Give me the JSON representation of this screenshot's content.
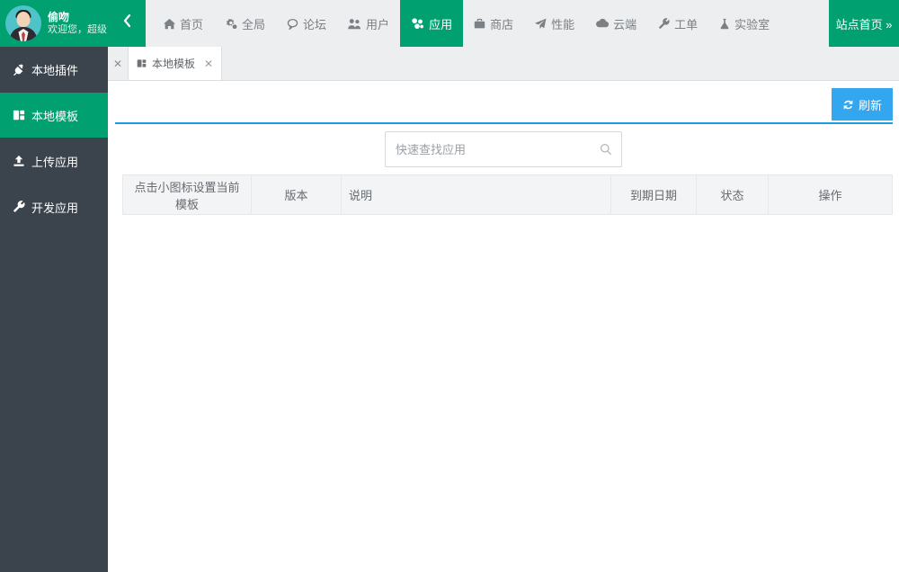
{
  "topbar": {
    "user": {
      "name": "偷吻",
      "subtitle": "欢迎您，超级管..."
    },
    "collapse_icon": "chevron-left-icon",
    "nav": [
      {
        "label": "首页",
        "icon": "home-icon",
        "active": false
      },
      {
        "label": "全局",
        "icon": "gears-icon",
        "active": false
      },
      {
        "label": "论坛",
        "icon": "comment-icon",
        "active": false
      },
      {
        "label": "用户",
        "icon": "users-icon",
        "active": false
      },
      {
        "label": "应用",
        "icon": "puzzle-icon",
        "active": true
      },
      {
        "label": "商店",
        "icon": "briefcase-icon",
        "active": false
      },
      {
        "label": "性能",
        "icon": "paper-plane-icon",
        "active": false
      },
      {
        "label": "云端",
        "icon": "cloud-icon",
        "active": false
      },
      {
        "label": "工单",
        "icon": "wrench-icon",
        "active": false
      },
      {
        "label": "实验室",
        "icon": "flask-icon",
        "active": false
      }
    ],
    "site_home_label": "站点首页 »"
  },
  "sidebar": {
    "items": [
      {
        "label": "本地插件",
        "icon": "plug-icon",
        "active": false
      },
      {
        "label": "本地模板",
        "icon": "template-icon",
        "active": true
      },
      {
        "label": "上传应用",
        "icon": "upload-icon",
        "active": false
      },
      {
        "label": "开发应用",
        "icon": "wrench-icon",
        "active": false
      }
    ]
  },
  "tabstrip": {
    "close_all_label": "✕",
    "tabs": [
      {
        "label": "本地模板",
        "icon": "template-icon",
        "close_label": "✕",
        "active": true
      }
    ]
  },
  "toolbar": {
    "refresh_label": "刷新",
    "refresh_icon": "refresh-icon",
    "accent_color": "#32a6ee"
  },
  "search": {
    "value": "",
    "placeholder": "快速查找应用",
    "icon": "search-icon"
  },
  "table": {
    "columns": [
      {
        "label": "点击小图标设置当前模板"
      },
      {
        "label": "版本"
      },
      {
        "label": "说明"
      },
      {
        "label": "到期日期"
      },
      {
        "label": "状态"
      },
      {
        "label": "操作"
      }
    ],
    "rows": []
  },
  "theme": {
    "green": "#00a070",
    "dark": "#3b444d",
    "blue": "#32a6ee",
    "topbar_bg": "#eceef0"
  }
}
